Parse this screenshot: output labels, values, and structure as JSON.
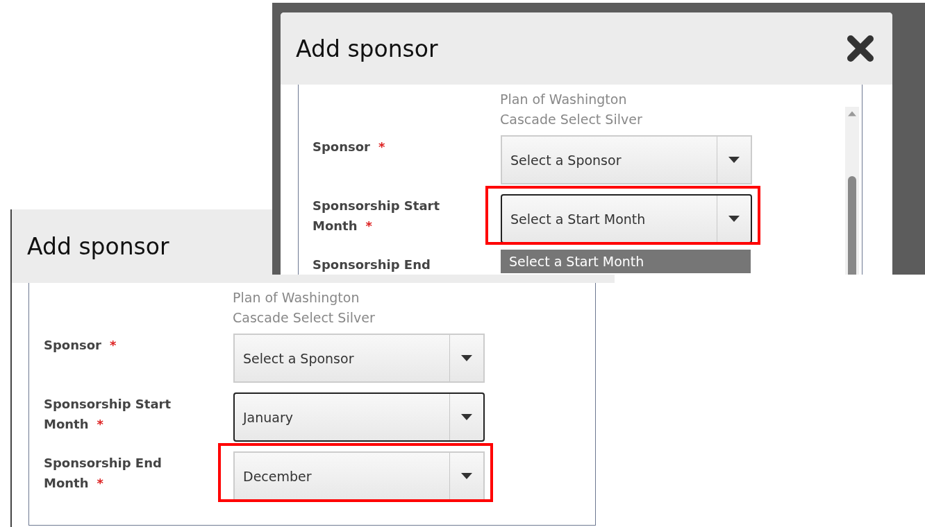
{
  "panels": [
    {
      "title": "Add sponsor",
      "close_icon": false,
      "scrollbar": false,
      "plan_lines": [
        "Plan of Washington",
        "Cascade Select Silver"
      ],
      "fields": [
        {
          "label": "Sponsor",
          "required_mark": "*",
          "value": "Select a Sponsor",
          "focused": false,
          "highlighted": false
        },
        {
          "label": "Sponsorship Start Month",
          "required_mark": "*",
          "value": "January",
          "focused": true,
          "highlighted": false
        },
        {
          "label": "Sponsorship End Month",
          "required_mark": "*",
          "value": "December",
          "focused": false,
          "highlighted": true
        }
      ]
    },
    {
      "title": "Add sponsor",
      "close_icon": true,
      "scrollbar": true,
      "plan_lines": [
        "Plan of Washington",
        "Cascade Select Silver"
      ],
      "fields": [
        {
          "label": "Sponsor",
          "required_mark": "*",
          "value": "Select a Sponsor",
          "focused": false,
          "highlighted": false
        },
        {
          "label": "Sponsorship Start Month",
          "required_mark": "*",
          "value": "Select a Start Month",
          "focused": true,
          "highlighted": true,
          "options": [
            {
              "label": "Select a Start Month",
              "selected": true
            }
          ]
        },
        {
          "label": "Sponsorship End"
        }
      ]
    }
  ]
}
